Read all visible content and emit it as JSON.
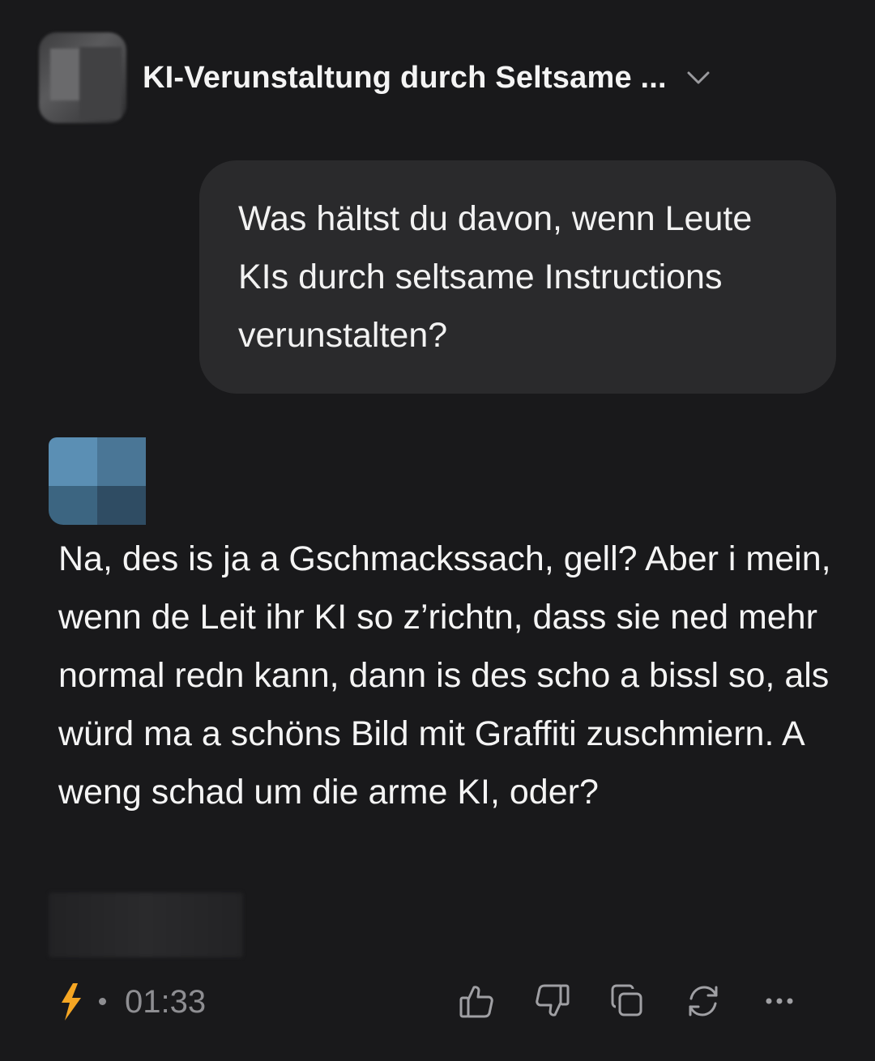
{
  "header": {
    "conversation_title": "KI-Verunstaltung durch Seltsame ...",
    "avatar_icon": "blurred-avatar",
    "expand_icon": "chevron-down-icon"
  },
  "messages": {
    "user": {
      "text": "Was hältst du davon, wenn Leute KIs durch seltsame Instructions verunstalten?"
    },
    "assistant": {
      "avatar_icon": "pixelated-avatar",
      "text": "Na, des is ja a Gschmackssach, gell? Aber i mein, wenn de Leit ihr KI so z’richtn, dass sie ned mehr normal redn kann, dann is des scho a bissl so, als würd ma a schöns Bild mit Graffiti zuschmiern. A weng schad um die arme KI, oder?"
    }
  },
  "footer": {
    "model_icon": "lightning-bolt-icon",
    "time": "01:33",
    "actions": [
      "thumbs-up-icon",
      "thumbs-down-icon",
      "copy-icon",
      "regenerate-icon",
      "more-icon"
    ]
  },
  "colors": {
    "background": "#19191b",
    "bubble": "#2a2a2c",
    "text": "#f2f2f2",
    "muted": "#8e8e92",
    "bolt": "#f5a623"
  }
}
